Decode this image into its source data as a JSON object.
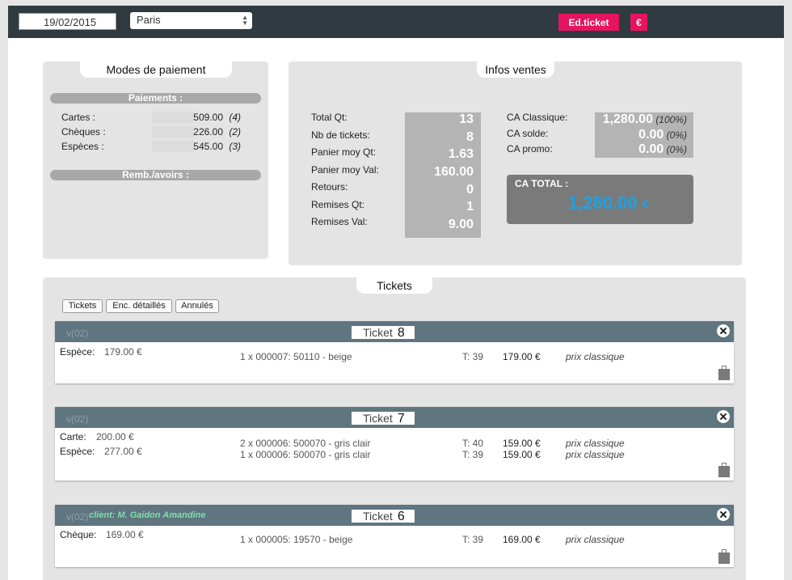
{
  "toolbar": {
    "date_value": "19/02/2015",
    "store_value": "Paris",
    "edticket_label": "Ed.ticket",
    "euro_label": "€"
  },
  "modes": {
    "title": "Modes de paiement",
    "payments_header": "Paiements :",
    "refunds_header": "Remb./avoirs :",
    "rows": [
      {
        "label": "Cartes :",
        "value": "509.00",
        "count": "(4)"
      },
      {
        "label": "Chèques :",
        "value": "226.00",
        "count": "(2)"
      },
      {
        "label": "Espèces :",
        "value": "545.00",
        "count": "(3)"
      }
    ]
  },
  "infos": {
    "title": "Infos ventes",
    "stats": [
      {
        "label": "Total Qt:",
        "value": "13"
      },
      {
        "label": "Nb de tickets:",
        "value": "8"
      },
      {
        "label": "Panier moy Qt:",
        "value": "1.63"
      },
      {
        "label": "Panier moy Val:",
        "value": "160.00"
      },
      {
        "label": "Retours:",
        "value": "0"
      },
      {
        "label": "Remises Qt:",
        "value": "1"
      },
      {
        "label": "Remises Val:",
        "value": "9.00"
      }
    ],
    "ca": [
      {
        "label": "CA Classique:",
        "value": "1,280.00",
        "pct": "(100%)"
      },
      {
        "label": "CA solde:",
        "value": "0.00",
        "pct": "(0%)"
      },
      {
        "label": "CA promo:",
        "value": "0.00",
        "pct": "(0%)"
      }
    ],
    "total_label": "CA TOTAL :",
    "total_value": "1,280.00",
    "total_currency": "€"
  },
  "tickets": {
    "title": "Tickets",
    "tabs": [
      "Tickets",
      "Enc. détaillés",
      "Annulés"
    ],
    "items": [
      {
        "version": "v(02)",
        "client": "",
        "label": "Ticket",
        "number": "8",
        "payments": [
          {
            "type": "Espèce:",
            "amount": "179.00 €"
          }
        ],
        "lines": [
          {
            "desc": "1 x 000007: 50110 - beige",
            "size": "T: 39",
            "price": "179.00 €",
            "mode": "prix classique"
          }
        ]
      },
      {
        "version": "v(02)",
        "client": "",
        "label": "Ticket",
        "number": "7",
        "payments": [
          {
            "type": "Carte:",
            "amount": "200.00 €"
          },
          {
            "type": "Espèce:",
            "amount": "277.00 €"
          }
        ],
        "lines": [
          {
            "desc": "2 x 000006: 500070 - gris clair",
            "size": "T: 40",
            "price": "159.00 €",
            "mode": "prix classique"
          },
          {
            "desc": "1 x 000006: 500070 - gris clair",
            "size": "T: 39",
            "price": "159.00 €",
            "mode": "prix classique"
          }
        ]
      },
      {
        "version": "v(02)",
        "client": "client: M. Gaidon Amandine",
        "label": "Ticket",
        "number": "6",
        "payments": [
          {
            "type": "Chèque:",
            "amount": "169.00 €"
          }
        ],
        "lines": [
          {
            "desc": "1 x 000005: 19570 - beige",
            "size": "T: 39",
            "price": "169.00 €",
            "mode": "prix classique"
          }
        ]
      }
    ]
  }
}
